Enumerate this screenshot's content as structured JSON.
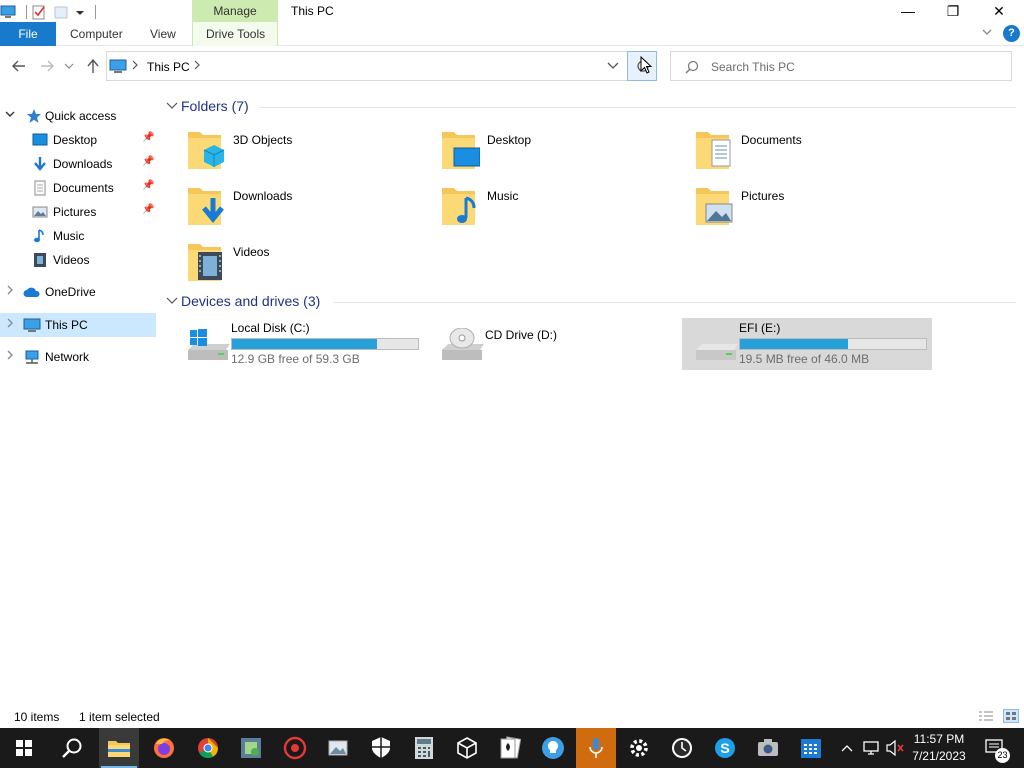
{
  "window": {
    "title": "This PC",
    "contextual_tab": "Manage",
    "caption": {
      "minimize": "—",
      "maximize": "❐",
      "close": "✕"
    }
  },
  "ribbon": {
    "tabs": [
      "File",
      "Computer",
      "View",
      "Drive Tools"
    ]
  },
  "navbar": {
    "breadcrumb": [
      "This PC"
    ],
    "search_placeholder": "Search This PC"
  },
  "nav_pane": {
    "quick_access": "Quick access",
    "quick_items": [
      {
        "label": "Desktop",
        "pinned": true
      },
      {
        "label": "Downloads",
        "pinned": true
      },
      {
        "label": "Documents",
        "pinned": true
      },
      {
        "label": "Pictures",
        "pinned": true
      },
      {
        "label": "Music",
        "pinned": false
      },
      {
        "label": "Videos",
        "pinned": false
      }
    ],
    "onedrive": "OneDrive",
    "this_pc": "This PC",
    "network": "Network"
  },
  "content": {
    "folders_header": "Folders (7)",
    "folders": [
      "3D Objects",
      "Desktop",
      "Documents",
      "Downloads",
      "Music",
      "Pictures",
      "Videos"
    ],
    "drives_header": "Devices and drives (3)",
    "drives": [
      {
        "name": "Local Disk (C:)",
        "free_text": "12.9 GB free of 59.3 GB",
        "used_fraction": 0.78
      },
      {
        "name": "CD Drive (D:)"
      },
      {
        "name": "EFI (E:)",
        "free_text": "19.5 MB free of 46.0 MB",
        "used_fraction": 0.58
      }
    ]
  },
  "statusbar": {
    "items": "10 items",
    "selected": "1 item selected"
  },
  "taskbar": {
    "time": "11:57 PM",
    "date": "7/21/2023",
    "notifications": "23"
  },
  "colors": {
    "accent": "#1979ca",
    "drive_bar": "#26a0da",
    "contextual_tab": "#cdebb0",
    "selection": "#cce8ff"
  }
}
